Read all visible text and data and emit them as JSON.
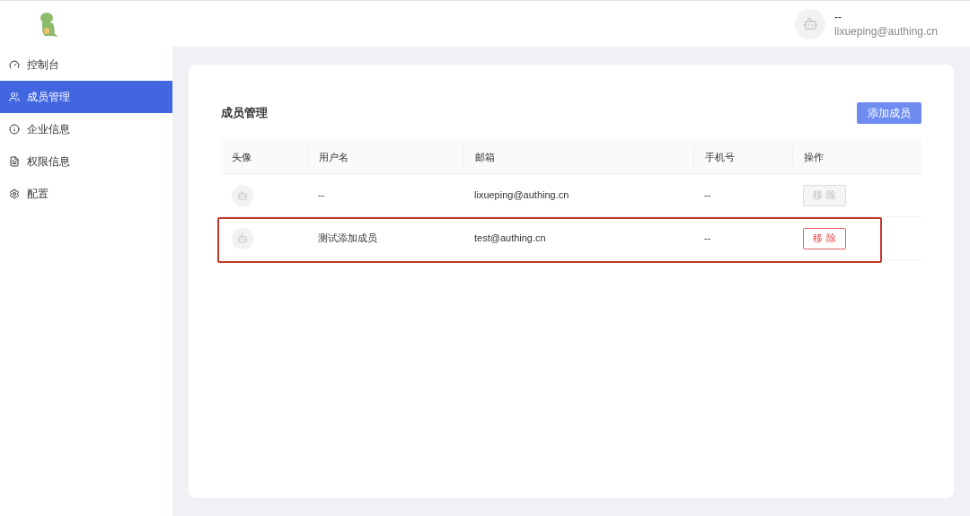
{
  "header": {
    "user": {
      "name": "--",
      "email": "lixueping@authing.cn"
    }
  },
  "sidebar": {
    "items": [
      {
        "label": "控制台",
        "kind": "dashboard",
        "selected": false
      },
      {
        "label": "成员管理",
        "kind": "members",
        "selected": true
      },
      {
        "label": "企业信息",
        "kind": "info",
        "selected": false
      },
      {
        "label": "权限信息",
        "kind": "permissions",
        "selected": false
      },
      {
        "label": "配置",
        "kind": "settings",
        "selected": false
      }
    ]
  },
  "page": {
    "title": "成员管理",
    "add_button": "添加成员"
  },
  "table": {
    "columns": [
      "头像",
      "用户名",
      "邮箱",
      "手机号",
      "操作"
    ],
    "rows": [
      {
        "username": "--",
        "email": "lixueping@authing.cn",
        "phone": "--",
        "action": "移 除",
        "disabled": true,
        "highlighted": false
      },
      {
        "username": "测试添加成员",
        "email": "test@authing.cn",
        "phone": "--",
        "action": "移 除",
        "disabled": false,
        "highlighted": true
      }
    ]
  }
}
